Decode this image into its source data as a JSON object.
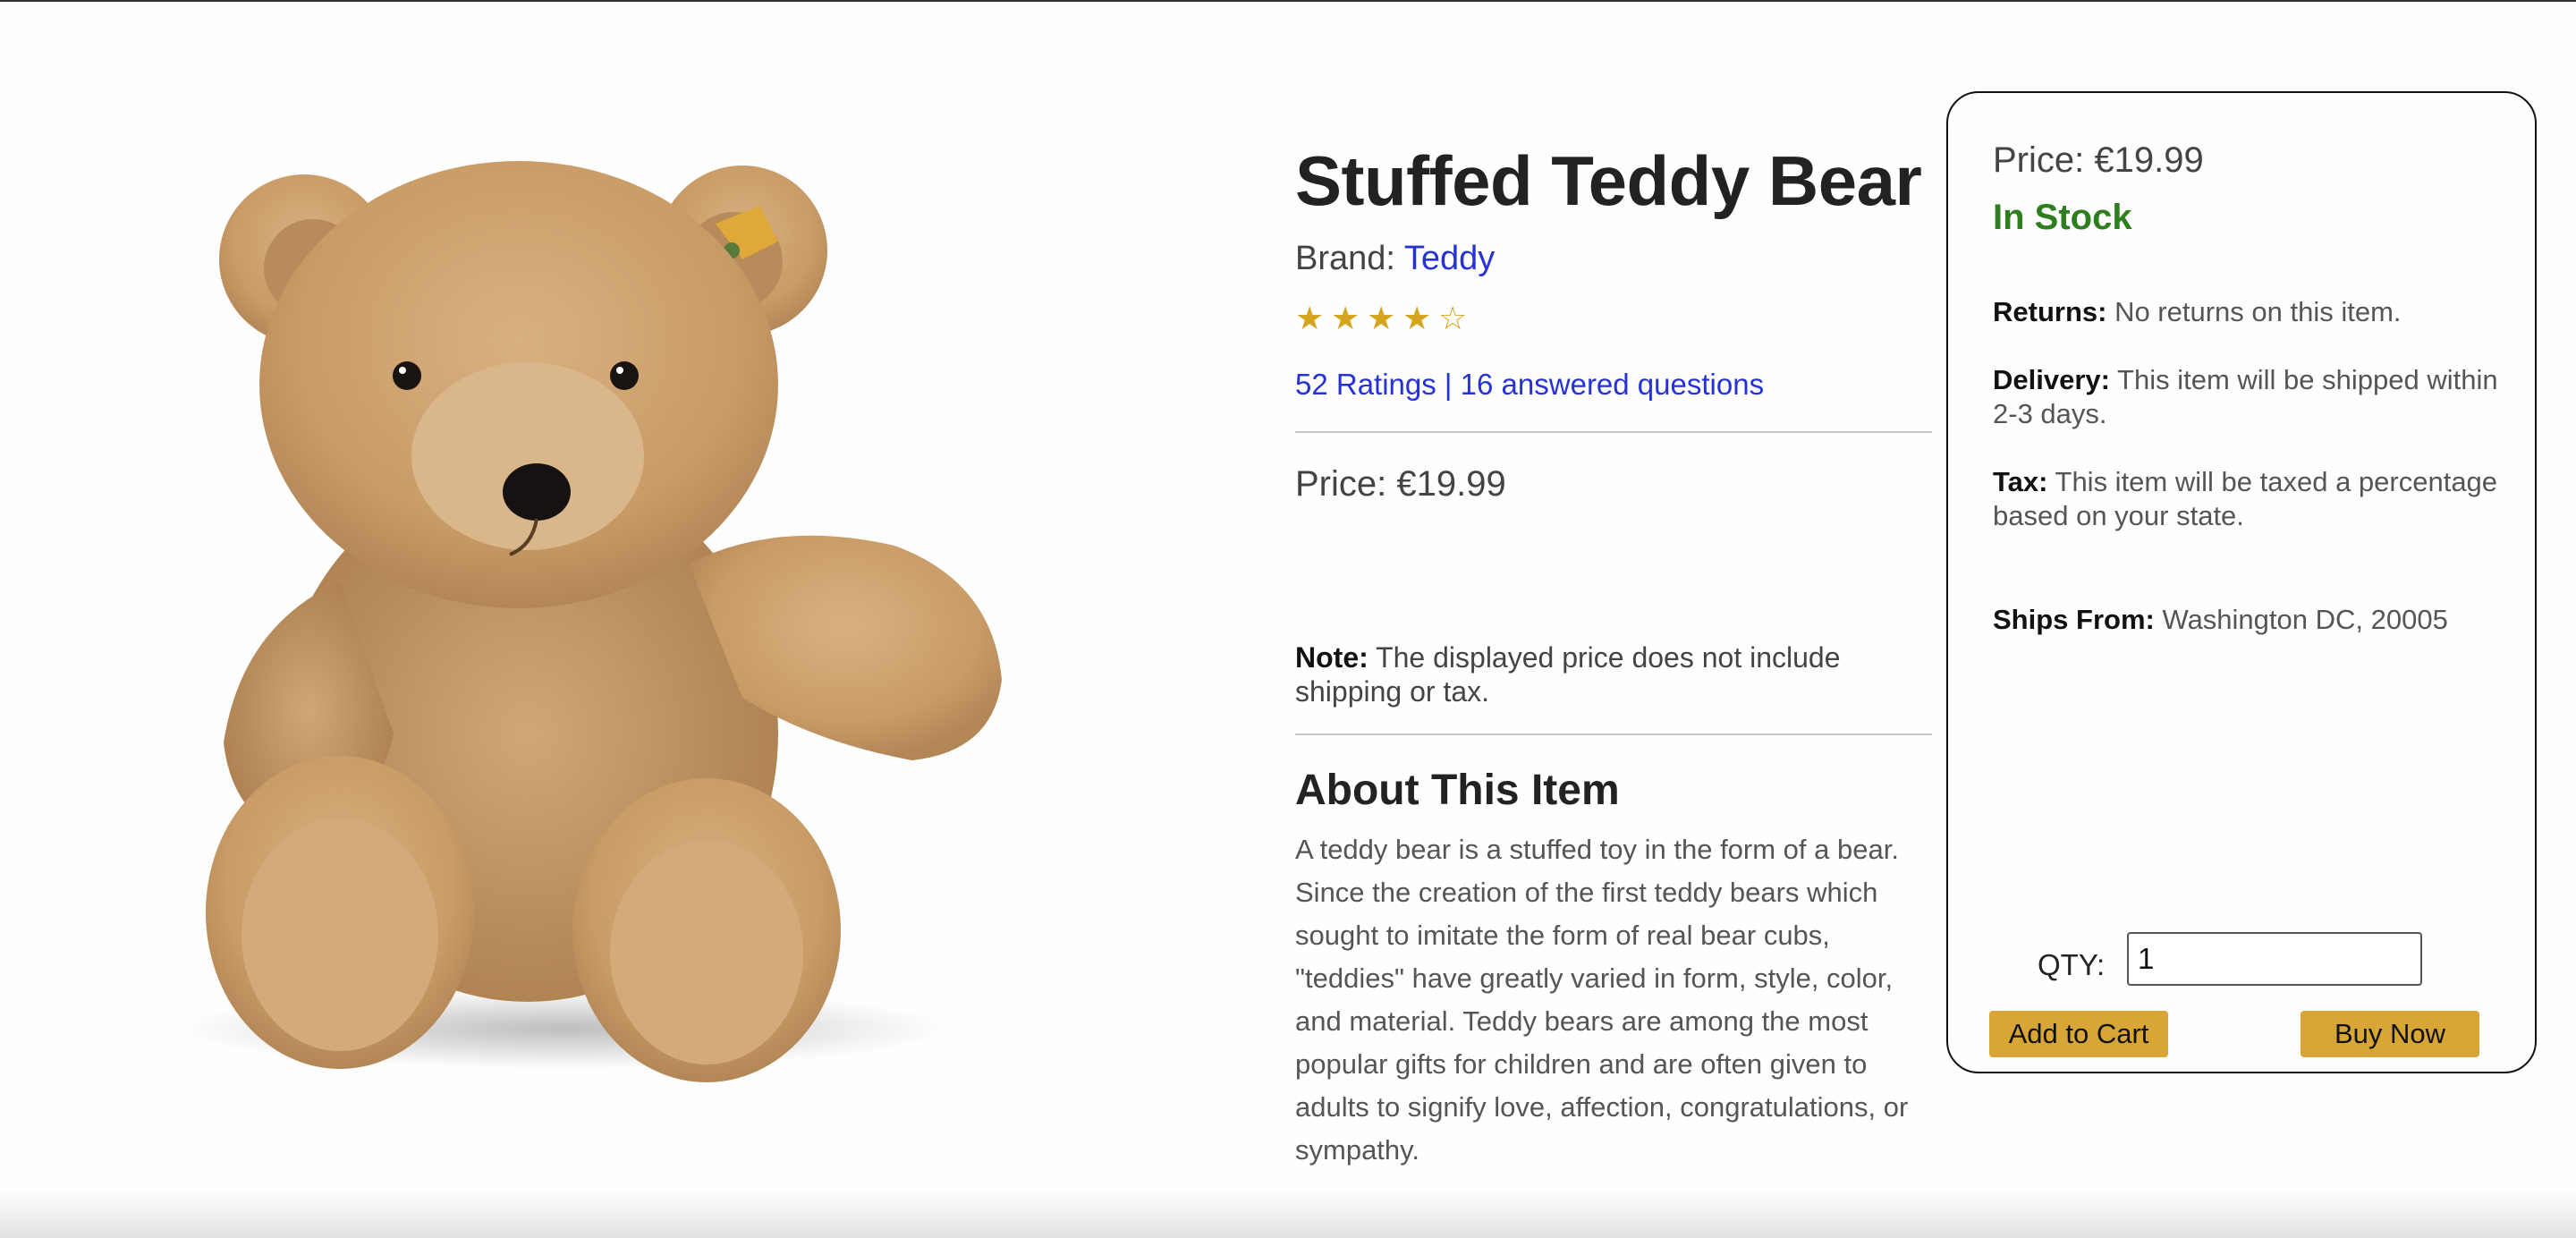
{
  "product": {
    "title": "Stuffed Teddy Bear",
    "brand_prefix": "Brand: ",
    "brand_name": "Teddy",
    "rating": {
      "filled_stars": 4,
      "total_stars": 5,
      "star_filled_glyph": "★",
      "star_empty_glyph": "☆",
      "star_color": "#d4a520"
    },
    "ratings_link": "52 Ratings | 16 answered questions",
    "price": "Price: €19.99",
    "note_label": "Note:",
    "note_text": " The displayed price does not include shipping or tax.",
    "about_title": "About This Item",
    "about_text": "A teddy bear is a stuffed toy in the form of a bear. Since the creation of the first teddy bears which sought to imitate the form of real bear cubs, \"teddies\" have greatly varied in form, style, color, and material. Teddy bears are among the most popular gifts for children and are often given to adults to signify love, affection, congratulations, or sympathy.",
    "image_icon": "teddy-bear-image"
  },
  "buy_box": {
    "price": "Price: €19.99",
    "stock_status": "In Stock",
    "stock_color": "#2e7d1e",
    "returns_label": "Returns:",
    "returns_text": " No returns on this item.",
    "delivery_label": "Delivery:",
    "delivery_text": " This item will be shipped within 2-3 days.",
    "tax_label": "Tax:",
    "tax_text": " This item will be taxed a percentage based on your state.",
    "ships_label": "Ships From:",
    "ships_text": " Washington DC, 20005",
    "qty_label": "QTY:",
    "qty_value": "1",
    "add_to_cart_label": "Add to Cart",
    "buy_now_label": "Buy Now",
    "button_color": "#d8a637"
  },
  "colors": {
    "link": "#2532d6"
  }
}
